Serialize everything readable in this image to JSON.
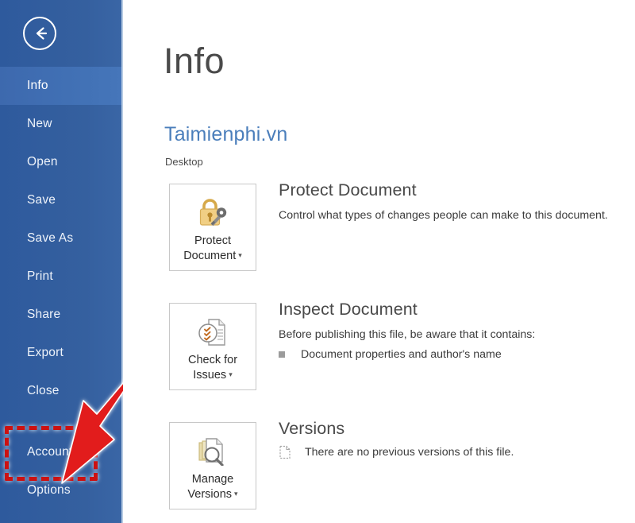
{
  "app": {
    "name": "Microsoft Word Backstage",
    "accent_blue": "#2d5a9e",
    "selected_blue": "#3f6cb0",
    "link_blue": "#4a7ebb",
    "annotation_red": "#cc1111"
  },
  "sidebar": {
    "back_icon": "back-arrow-icon",
    "items": [
      {
        "label": "Info",
        "selected": true
      },
      {
        "label": "New",
        "selected": false
      },
      {
        "label": "Open",
        "selected": false
      },
      {
        "label": "Save",
        "selected": false
      },
      {
        "label": "Save As",
        "selected": false
      },
      {
        "label": "Print",
        "selected": false
      },
      {
        "label": "Share",
        "selected": false
      },
      {
        "label": "Export",
        "selected": false
      },
      {
        "label": "Close",
        "selected": false
      },
      {
        "label": "Account",
        "selected": false
      },
      {
        "label": "Options",
        "selected": false
      }
    ]
  },
  "annotation": {
    "highlighted_item": "Account",
    "shape": "red-dashed-rectangle",
    "pointer": "red-arrow"
  },
  "main": {
    "page_title": "Info",
    "document_name": "Taimienphi.vn",
    "document_path": "Desktop",
    "sections": [
      {
        "id": "protect-document",
        "button_label": "Protect\nDocument",
        "button_icon": "lock-key-icon",
        "has_caret": true,
        "heading": "Protect Document",
        "description": "Control what types of changes people can make to this document.",
        "bullets": []
      },
      {
        "id": "inspect-document",
        "button_label": "Check for\nIssues",
        "button_icon": "document-checklist-icon",
        "has_caret": true,
        "heading": "Inspect Document",
        "description": "Before publishing this file, be aware that it contains:",
        "bullets": [
          "Document properties and author's name"
        ]
      },
      {
        "id": "versions",
        "button_label": "Manage\nVersions",
        "button_icon": "document-stack-magnifier-icon",
        "has_caret": true,
        "heading": "Versions",
        "description": "",
        "version_note": "There are no previous versions of this file.",
        "version_icon": "document-outline-icon",
        "bullets": []
      }
    ]
  }
}
